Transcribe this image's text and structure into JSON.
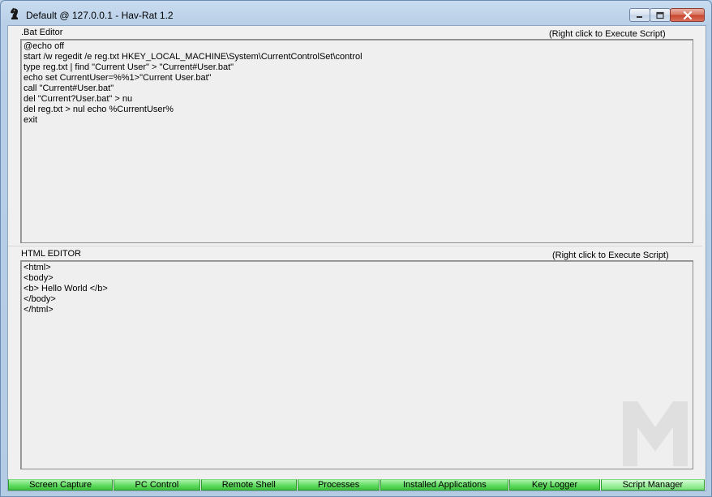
{
  "window": {
    "title": "Default @ 127.0.0.1 - Hav-Rat 1.2",
    "icon": "chess-knight-icon"
  },
  "colors": {
    "tab_green": "#61dc61",
    "close_red": "#c7442d",
    "client_bg": "#f0f0f0"
  },
  "bat_editor": {
    "label": ".Bat Editor",
    "hint": "(Right click to Execute Script)",
    "lines": [
      "@echo off",
      "start /w regedit /e reg.txt HKEY_LOCAL_MACHINE\\System\\CurrentControlSet\\control",
      "type reg.txt | find \"Current User\" > \"Current#User.bat\"",
      "echo set CurrentUser=%%1>\"Current User.bat\"",
      "call \"Current#User.bat\"",
      "del \"Current?User.bat\" > nu",
      "del reg.txt > nul echo %CurrentUser%",
      "exit"
    ]
  },
  "html_editor": {
    "label": "HTML EDITOR",
    "hint": "(Right click to Execute Script)",
    "lines": [
      "<html>",
      "<body>",
      "<b> Hello World </b>",
      "</body>",
      "</html>"
    ]
  },
  "tabs": [
    {
      "label": "Screen Capture"
    },
    {
      "label": "PC Control"
    },
    {
      "label": "Remote Shell"
    },
    {
      "label": "Processes"
    },
    {
      "label": "Installed Applications"
    },
    {
      "label": "Key Logger"
    },
    {
      "label": "Script Manager",
      "active": true
    }
  ]
}
